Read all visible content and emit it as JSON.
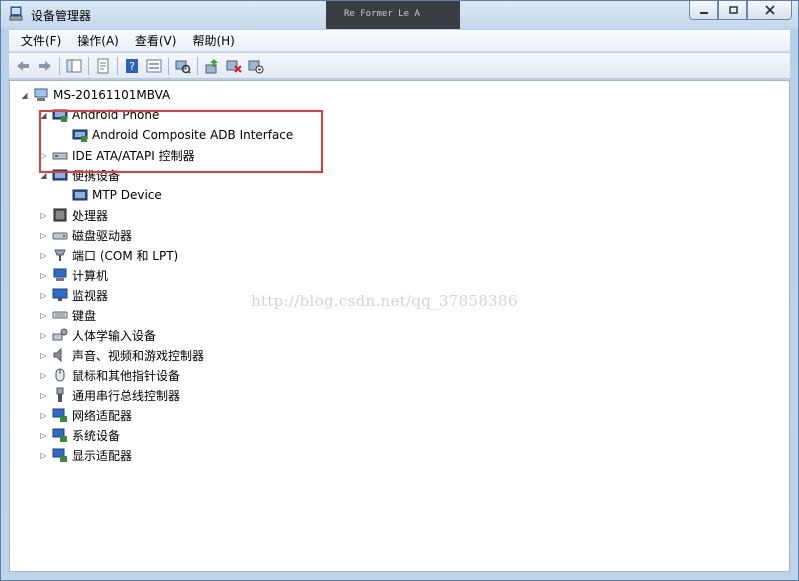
{
  "window": {
    "title": "设备管理器",
    "background_ghost_text": "Re Former Le A",
    "caption_buttons": [
      "minimize",
      "restore",
      "close"
    ]
  },
  "menu": {
    "items": [
      {
        "label": "文件(F)"
      },
      {
        "label": "操作(A)"
      },
      {
        "label": "查看(V)"
      },
      {
        "label": "帮助(H)"
      }
    ]
  },
  "toolbar": {
    "buttons": [
      {
        "icon": "back-arrow-icon"
      },
      {
        "icon": "forward-arrow-icon"
      },
      {
        "icon": "show-hide-console-tree-icon"
      },
      {
        "icon": "properties-icon"
      },
      {
        "icon": "help-icon"
      },
      {
        "icon": "view-icon"
      },
      {
        "icon": "scan-hardware-icon"
      },
      {
        "icon": "update-driver-icon"
      },
      {
        "icon": "uninstall-icon"
      },
      {
        "icon": "disable-icon"
      }
    ]
  },
  "tree": {
    "root": "MS-20161101MBVA",
    "nodes": [
      {
        "label": "Android Phone",
        "level": 1,
        "expanded": true,
        "icon": "android-phone-icon"
      },
      {
        "label": "Android Composite ADB Interface",
        "level": 2,
        "icon": "usb-device-icon"
      },
      {
        "label": "IDE ATA/ATAPI 控制器",
        "level": 1,
        "expanded": false,
        "icon": "ide-controller-icon"
      },
      {
        "label": "便携设备",
        "level": 1,
        "expanded": true,
        "icon": "portable-device-icon"
      },
      {
        "label": "MTP Device",
        "level": 2,
        "icon": "mtp-device-icon"
      },
      {
        "label": "处理器",
        "level": 1,
        "expanded": false,
        "icon": "processor-icon"
      },
      {
        "label": "磁盘驱动器",
        "level": 1,
        "expanded": false,
        "icon": "disk-drive-icon"
      },
      {
        "label": "端口 (COM 和 LPT)",
        "level": 1,
        "expanded": false,
        "icon": "port-icon"
      },
      {
        "label": "计算机",
        "level": 1,
        "expanded": false,
        "icon": "computer-icon"
      },
      {
        "label": "监视器",
        "level": 1,
        "expanded": false,
        "icon": "monitor-icon"
      },
      {
        "label": "键盘",
        "level": 1,
        "expanded": false,
        "icon": "keyboard-icon"
      },
      {
        "label": "人体学输入设备",
        "level": 1,
        "expanded": false,
        "icon": "hid-icon"
      },
      {
        "label": "声音、视频和游戏控制器",
        "level": 1,
        "expanded": false,
        "icon": "sound-icon"
      },
      {
        "label": "鼠标和其他指针设备",
        "level": 1,
        "expanded": false,
        "icon": "mouse-icon"
      },
      {
        "label": "通用串行总线控制器",
        "level": 1,
        "expanded": false,
        "icon": "usb-controller-icon"
      },
      {
        "label": "网络适配器",
        "level": 1,
        "expanded": false,
        "icon": "network-adapter-icon"
      },
      {
        "label": "系统设备",
        "level": 1,
        "expanded": false,
        "icon": "system-device-icon"
      },
      {
        "label": "显示适配器",
        "level": 1,
        "expanded": false,
        "icon": "display-adapter-icon"
      }
    ]
  },
  "watermark": "http://blog.csdn.net/qq_37858386",
  "colors": {
    "highlight_border": "#e83a3a",
    "title_gradient_top": "#dbe8f6",
    "title_gradient_bottom": "#c4d7ec"
  }
}
